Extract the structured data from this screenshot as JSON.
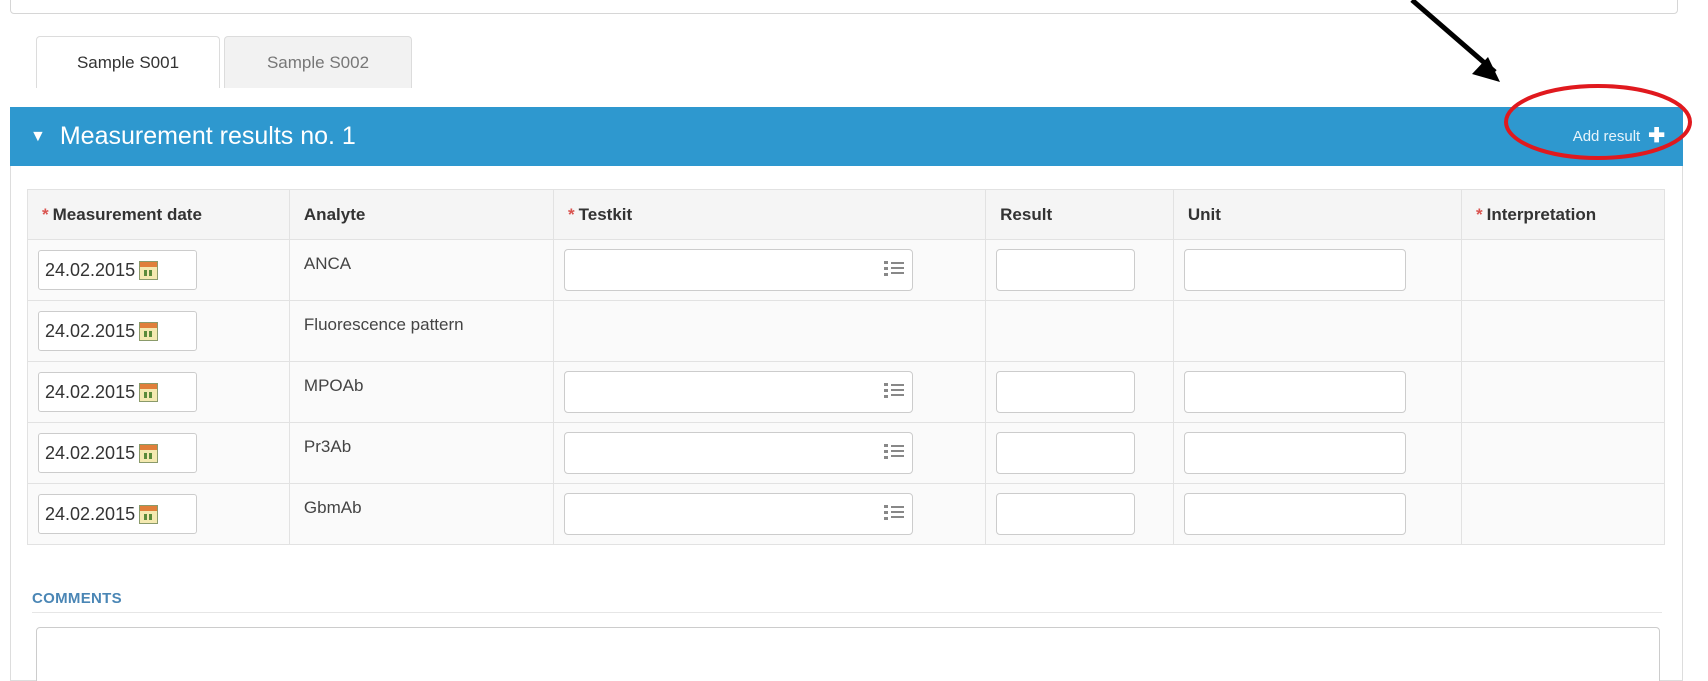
{
  "tabs": [
    {
      "label": "Sample S001",
      "active": true
    },
    {
      "label": "Sample S002",
      "active": false
    }
  ],
  "panel": {
    "collapse_icon": "triangle-down-icon",
    "title": "Measurement results no. 1",
    "add_result_label": "Add result",
    "add_result_icon": "plus-icon",
    "header_color": "#2e98cf"
  },
  "table": {
    "required_marker": "*",
    "columns": {
      "date": "Measurement date",
      "analyte": "Analyte",
      "testkit": "Testkit",
      "result": "Result",
      "unit": "Unit",
      "interpretation": "Interpretation"
    },
    "rows": [
      {
        "date": "24.02.2015",
        "analyte": "ANCA",
        "has_inputs": true
      },
      {
        "date": "24.02.2015",
        "analyte": "Fluorescence pattern",
        "has_inputs": false
      },
      {
        "date": "24.02.2015",
        "analyte": "MPOAb",
        "has_inputs": true
      },
      {
        "date": "24.02.2015",
        "analyte": "Pr3Ab",
        "has_inputs": true
      },
      {
        "date": "24.02.2015",
        "analyte": "GbmAb",
        "has_inputs": true
      }
    ]
  },
  "comments": {
    "label": "COMMENTS",
    "value": ""
  },
  "annotation": {
    "arrow_color": "#000000",
    "circle_color": "#e0191e"
  }
}
